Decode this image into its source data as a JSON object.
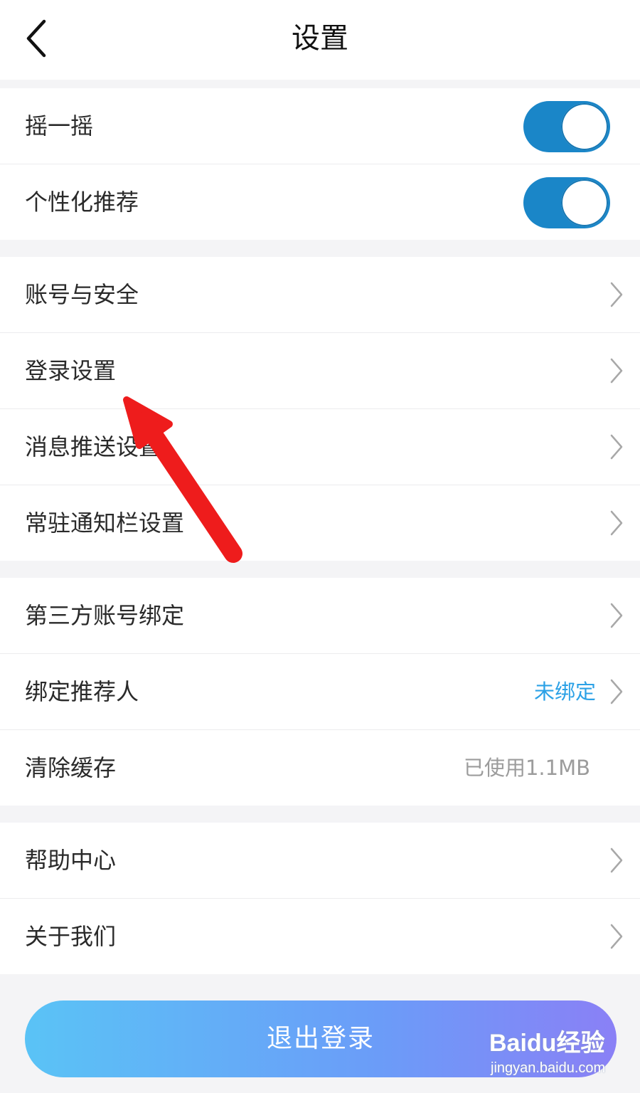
{
  "header": {
    "title": "设置"
  },
  "groups": [
    {
      "rows": [
        {
          "label": "摇一摇",
          "toggle": true
        },
        {
          "label": "个性化推荐",
          "toggle": true
        }
      ]
    },
    {
      "rows": [
        {
          "label": "账号与安全"
        },
        {
          "label": "登录设置"
        },
        {
          "label": "消息推送设置"
        },
        {
          "label": "常驻通知栏设置"
        }
      ]
    },
    {
      "rows": [
        {
          "label": "第三方账号绑定"
        },
        {
          "label": "绑定推荐人",
          "value": "未绑定"
        },
        {
          "label": "清除缓存",
          "value": "已使用1.1MB"
        }
      ]
    },
    {
      "rows": [
        {
          "label": "帮助中心"
        },
        {
          "label": "关于我们"
        }
      ]
    }
  ],
  "logout_label": "退出登录",
  "watermark": {
    "logo": "Baidu经验",
    "url": "jingyan.baidu.com"
  },
  "colors": {
    "toggle_on": "#1a86c8",
    "accent_blue": "#2ba1e6",
    "annotation_arrow": "#ee1c1c"
  }
}
